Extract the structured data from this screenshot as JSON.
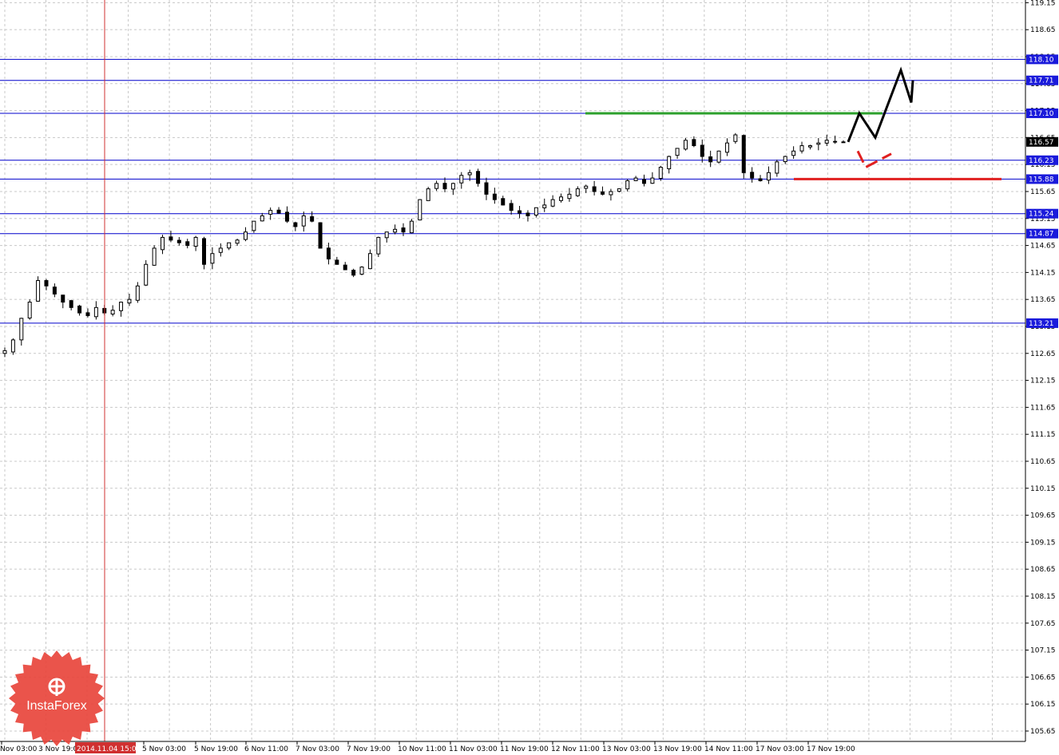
{
  "chart_data": {
    "type": "candlestick",
    "instrument_timeframe": "",
    "y_ticks": [
      "119.15",
      "118.65",
      "118.15",
      "117.65",
      "117.15",
      "116.65",
      "116.15",
      "115.65",
      "115.15",
      "114.65",
      "114.15",
      "113.65",
      "113.15",
      "112.65",
      "112.15",
      "111.65",
      "111.15",
      "110.65",
      "110.15",
      "109.65",
      "109.15",
      "108.65",
      "108.15",
      "107.65",
      "107.15",
      "106.65",
      "106.15",
      "105.65"
    ],
    "ylim": [
      105.55,
      119.2
    ],
    "x_ticks": [
      "Nov 03:00",
      "3 Nov 19:00",
      "5 Nov 03:00",
      "5 Nov 19:00",
      "6 Nov 11:00",
      "7 Nov 03:00",
      "7 Nov 19:00",
      "10 Nov 11:00",
      "11 Nov 03:00",
      "11 Nov 19:00",
      "12 Nov 11:00",
      "13 Nov 03:00",
      "13 Nov 19:00",
      "14 Nov 11:00",
      "17 Nov 03:00",
      "17 Nov 19:00"
    ],
    "cursor_time_label": "2014.11.04 15:00",
    "current_price": "116.57",
    "horizontal_levels": [
      {
        "label": "118.10",
        "value": 118.1,
        "color": "#0000cc"
      },
      {
        "label": "117.71",
        "value": 117.71,
        "color": "#0000cc"
      },
      {
        "label": "117.10",
        "value": 117.1,
        "color": "#0000cc"
      },
      {
        "label": "116.23",
        "value": 116.23,
        "color": "#0000cc"
      },
      {
        "label": "115.88",
        "value": 115.88,
        "color": "#0000cc"
      },
      {
        "label": "115.24",
        "value": 115.24,
        "color": "#0000cc"
      },
      {
        "label": "114.87",
        "value": 114.87,
        "color": "#0000cc"
      },
      {
        "label": "113.21",
        "value": 113.21,
        "color": "#0000cc"
      }
    ],
    "resistance_line": {
      "value": 117.1,
      "color": "#2ca02c"
    },
    "support_line": {
      "value": 115.88,
      "color": "#e02020"
    },
    "forecast_path_up": [
      116.57,
      117.1,
      116.65,
      117.9,
      117.3,
      117.71
    ],
    "forecast_path_alt": [
      116.4,
      116.1,
      116.35
    ],
    "price_series": [
      112.7,
      112.9,
      113.3,
      113.6,
      114.0,
      113.9,
      113.75,
      113.6,
      113.5,
      113.4,
      113.35,
      113.5,
      113.4,
      113.45,
      113.6,
      113.65,
      113.9,
      114.3,
      114.6,
      114.8,
      114.75,
      114.7,
      114.65,
      114.8,
      114.3,
      114.5,
      114.6,
      114.7,
      114.75,
      114.9,
      115.1,
      115.2,
      115.3,
      115.25,
      115.1,
      115.0,
      115.2,
      115.1,
      114.6,
      114.4,
      114.3,
      114.2,
      114.1,
      114.25,
      114.5,
      114.8,
      114.9,
      114.95,
      114.9,
      115.1,
      115.5,
      115.7,
      115.8,
      115.7,
      115.8,
      115.95,
      116.0,
      115.8,
      115.6,
      115.5,
      115.4,
      115.3,
      115.25,
      115.2,
      115.35,
      115.4,
      115.5,
      115.55,
      115.6,
      115.7,
      115.75,
      115.65,
      115.6,
      115.65,
      115.7,
      115.85,
      115.9,
      115.8,
      115.9,
      116.1,
      116.3,
      116.45,
      116.6,
      116.5,
      116.3,
      116.2,
      116.4,
      116.55,
      116.7,
      116.0,
      115.9,
      115.85,
      116.0,
      116.2,
      116.3,
      116.4,
      116.5,
      116.5,
      116.55,
      116.6,
      116.58,
      116.57
    ]
  },
  "branding": {
    "logo_name": "InstaForex"
  }
}
